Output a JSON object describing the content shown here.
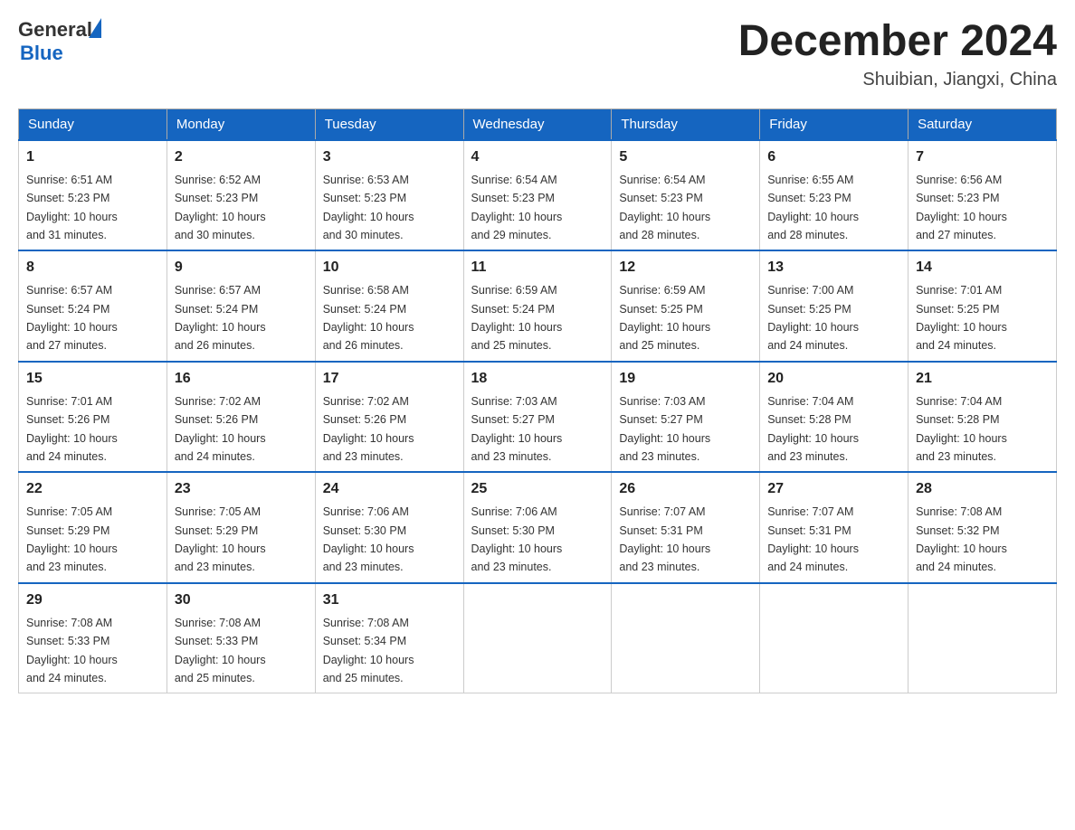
{
  "header": {
    "logo_general": "General",
    "logo_blue": "Blue",
    "month_title": "December 2024",
    "subtitle": "Shuibian, Jiangxi, China"
  },
  "days_of_week": [
    "Sunday",
    "Monday",
    "Tuesday",
    "Wednesday",
    "Thursday",
    "Friday",
    "Saturday"
  ],
  "weeks": [
    [
      {
        "day": "1",
        "sunrise": "6:51 AM",
        "sunset": "5:23 PM",
        "daylight": "10 hours and 31 minutes."
      },
      {
        "day": "2",
        "sunrise": "6:52 AM",
        "sunset": "5:23 PM",
        "daylight": "10 hours and 30 minutes."
      },
      {
        "day": "3",
        "sunrise": "6:53 AM",
        "sunset": "5:23 PM",
        "daylight": "10 hours and 30 minutes."
      },
      {
        "day": "4",
        "sunrise": "6:54 AM",
        "sunset": "5:23 PM",
        "daylight": "10 hours and 29 minutes."
      },
      {
        "day": "5",
        "sunrise": "6:54 AM",
        "sunset": "5:23 PM",
        "daylight": "10 hours and 28 minutes."
      },
      {
        "day": "6",
        "sunrise": "6:55 AM",
        "sunset": "5:23 PM",
        "daylight": "10 hours and 28 minutes."
      },
      {
        "day": "7",
        "sunrise": "6:56 AM",
        "sunset": "5:23 PM",
        "daylight": "10 hours and 27 minutes."
      }
    ],
    [
      {
        "day": "8",
        "sunrise": "6:57 AM",
        "sunset": "5:24 PM",
        "daylight": "10 hours and 27 minutes."
      },
      {
        "day": "9",
        "sunrise": "6:57 AM",
        "sunset": "5:24 PM",
        "daylight": "10 hours and 26 minutes."
      },
      {
        "day": "10",
        "sunrise": "6:58 AM",
        "sunset": "5:24 PM",
        "daylight": "10 hours and 26 minutes."
      },
      {
        "day": "11",
        "sunrise": "6:59 AM",
        "sunset": "5:24 PM",
        "daylight": "10 hours and 25 minutes."
      },
      {
        "day": "12",
        "sunrise": "6:59 AM",
        "sunset": "5:25 PM",
        "daylight": "10 hours and 25 minutes."
      },
      {
        "day": "13",
        "sunrise": "7:00 AM",
        "sunset": "5:25 PM",
        "daylight": "10 hours and 24 minutes."
      },
      {
        "day": "14",
        "sunrise": "7:01 AM",
        "sunset": "5:25 PM",
        "daylight": "10 hours and 24 minutes."
      }
    ],
    [
      {
        "day": "15",
        "sunrise": "7:01 AM",
        "sunset": "5:26 PM",
        "daylight": "10 hours and 24 minutes."
      },
      {
        "day": "16",
        "sunrise": "7:02 AM",
        "sunset": "5:26 PM",
        "daylight": "10 hours and 24 minutes."
      },
      {
        "day": "17",
        "sunrise": "7:02 AM",
        "sunset": "5:26 PM",
        "daylight": "10 hours and 23 minutes."
      },
      {
        "day": "18",
        "sunrise": "7:03 AM",
        "sunset": "5:27 PM",
        "daylight": "10 hours and 23 minutes."
      },
      {
        "day": "19",
        "sunrise": "7:03 AM",
        "sunset": "5:27 PM",
        "daylight": "10 hours and 23 minutes."
      },
      {
        "day": "20",
        "sunrise": "7:04 AM",
        "sunset": "5:28 PM",
        "daylight": "10 hours and 23 minutes."
      },
      {
        "day": "21",
        "sunrise": "7:04 AM",
        "sunset": "5:28 PM",
        "daylight": "10 hours and 23 minutes."
      }
    ],
    [
      {
        "day": "22",
        "sunrise": "7:05 AM",
        "sunset": "5:29 PM",
        "daylight": "10 hours and 23 minutes."
      },
      {
        "day": "23",
        "sunrise": "7:05 AM",
        "sunset": "5:29 PM",
        "daylight": "10 hours and 23 minutes."
      },
      {
        "day": "24",
        "sunrise": "7:06 AM",
        "sunset": "5:30 PM",
        "daylight": "10 hours and 23 minutes."
      },
      {
        "day": "25",
        "sunrise": "7:06 AM",
        "sunset": "5:30 PM",
        "daylight": "10 hours and 23 minutes."
      },
      {
        "day": "26",
        "sunrise": "7:07 AM",
        "sunset": "5:31 PM",
        "daylight": "10 hours and 23 minutes."
      },
      {
        "day": "27",
        "sunrise": "7:07 AM",
        "sunset": "5:31 PM",
        "daylight": "10 hours and 24 minutes."
      },
      {
        "day": "28",
        "sunrise": "7:08 AM",
        "sunset": "5:32 PM",
        "daylight": "10 hours and 24 minutes."
      }
    ],
    [
      {
        "day": "29",
        "sunrise": "7:08 AM",
        "sunset": "5:33 PM",
        "daylight": "10 hours and 24 minutes."
      },
      {
        "day": "30",
        "sunrise": "7:08 AM",
        "sunset": "5:33 PM",
        "daylight": "10 hours and 25 minutes."
      },
      {
        "day": "31",
        "sunrise": "7:08 AM",
        "sunset": "5:34 PM",
        "daylight": "10 hours and 25 minutes."
      },
      null,
      null,
      null,
      null
    ]
  ],
  "labels": {
    "sunrise": "Sunrise:",
    "sunset": "Sunset:",
    "daylight": "Daylight:"
  }
}
